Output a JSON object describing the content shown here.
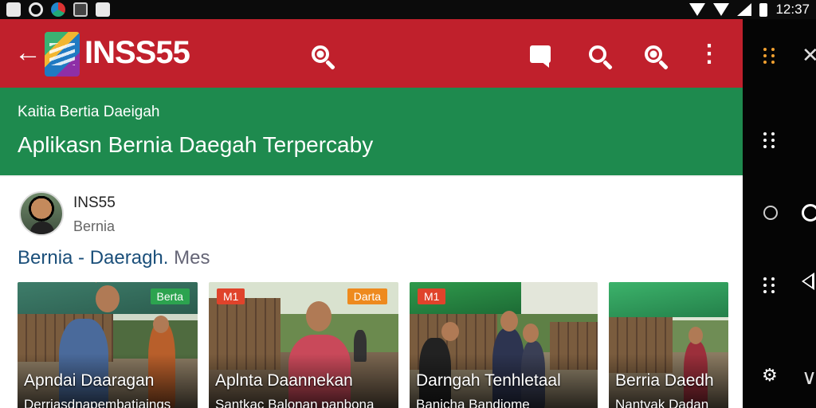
{
  "status_bar": {
    "time": "12:37",
    "left_icons": [
      "photo-icon",
      "circle-notification-icon",
      "app-notification-icon",
      "file-icon",
      "security-icon"
    ],
    "right_icons": [
      "wifi-icon",
      "signal-icon",
      "signal-off-icon",
      "battery-icon"
    ]
  },
  "toolbar": {
    "back_icon": "arrow-left",
    "title": "INSS55",
    "actions": [
      "search-key-icon",
      "chat-icon",
      "search-icon",
      "search-filled-icon",
      "more-vert-icon"
    ]
  },
  "banner": {
    "subtitle": "Kaitia Bertia Daeigah",
    "title": "Aplikasn Bernia Daegah Terpercaby"
  },
  "publisher": {
    "name": "INS55",
    "category": "Bernia"
  },
  "section": {
    "title": "Bernia - Daeragh.",
    "more": "Mes"
  },
  "articles": [
    {
      "badge": "Berta",
      "badge_color": "green",
      "title": "Apndai Daaragan",
      "subtitle": "Derriasdnapembatiaings"
    },
    {
      "badge": "M1",
      "badge2": "Darta",
      "badge_color": "red",
      "title": "Aplnta Daannekan",
      "subtitle": "Santkac Balonan panbona"
    },
    {
      "badge": "M1",
      "badge_color": "red",
      "title": "Darngah Tenhletaal",
      "subtitle": "Banicha Bandiome"
    },
    {
      "badge": "",
      "badge_color": "",
      "title": "Berria Daedh",
      "subtitle": "Nantvak Dadan"
    }
  ],
  "nav_rail": {
    "items": [
      "apps-grid-icon",
      "drag-handle-icon",
      "home-circle-icon",
      "grid-icon",
      "settings-icon"
    ],
    "partial_items": [
      "close-icon",
      "circle-icon",
      "back-icon",
      "chevron-icon"
    ]
  },
  "colors": {
    "toolbar": "#c0202c",
    "banner": "#1e8a4e",
    "section_title": "#1b4f7a"
  }
}
